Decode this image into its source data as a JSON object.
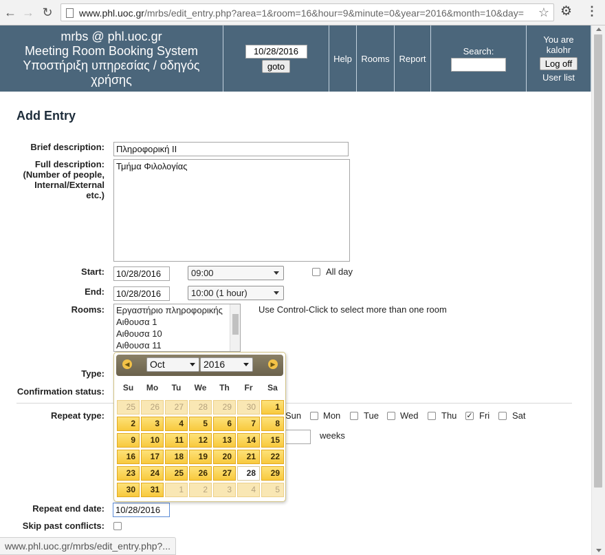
{
  "browser": {
    "back_icon": "back-arrow-icon",
    "forward_icon": "forward-arrow-icon",
    "reload_icon": "reload-icon",
    "url_host": "www.phl.uoc.gr",
    "url_path": "/mrbs/edit_entry.php?area=1&room=16&hour=9&minute=0&year=2016&month=10&day=",
    "status_url": "www.phl.uoc.gr/mrbs/edit_entry.php?..."
  },
  "banner": {
    "title_lines": [
      "mrbs @ phl.uoc.gr",
      "Meeting Room Booking System",
      "Υποστήριξη υπηρεσίας / οδηγός",
      "χρήσης"
    ],
    "goto_date": "10/28/2016",
    "goto_label": "goto",
    "help": "Help",
    "rooms": "Rooms",
    "report": "Report",
    "search_label": "Search:",
    "you_are": "You are",
    "user": "kalohr",
    "logoff": "Log off",
    "user_list": "User list",
    "bg_color": "#4b667b"
  },
  "form": {
    "heading": "Add Entry",
    "brief_label": "Brief description:",
    "brief_value": "Πληροφορική ΙΙ",
    "full_label_lines": [
      "Full description:",
      "(Number of people,",
      "Internal/External",
      "etc.)"
    ],
    "full_value": "Τμήμα Φιλολογίας",
    "start_label": "Start:",
    "start_date": "10/28/2016",
    "start_time": "09:00",
    "allday_label": "All day",
    "end_label": "End:",
    "end_date": "10/28/2016",
    "end_time": "10:00  (1 hour)",
    "rooms_label": "Rooms:",
    "rooms": [
      "Εργαστήριο πληροφορικής",
      "Αιθουσα 1",
      "Αιθουσα 10",
      "Αιθουσα 11"
    ],
    "rooms_hint": "Use Control-Click to select more than one room",
    "type_label": "Type:",
    "confirm_label": "Confirmation status:",
    "repeat_type_label": "Repeat type:",
    "weekdays": [
      {
        "label": "Sun",
        "checked": false
      },
      {
        "label": "Mon",
        "checked": false
      },
      {
        "label": "Tue",
        "checked": false
      },
      {
        "label": "Wed",
        "checked": false
      },
      {
        "label": "Thu",
        "checked": false
      },
      {
        "label": "Fri",
        "checked": true
      },
      {
        "label": "Sat",
        "checked": false
      }
    ],
    "weeks_label": "weeks",
    "repeat_end_label": "Repeat end date:",
    "repeat_end_value": "10/28/2016",
    "skip_label": "Skip past conflicts:"
  },
  "datepicker": {
    "month": "Oct",
    "year": "2016",
    "prev_icon": "prev-month-icon",
    "next_icon": "next-month-icon",
    "dow": [
      "Su",
      "Mo",
      "Tu",
      "We",
      "Th",
      "Fr",
      "Sa"
    ],
    "weeks": [
      [
        "25",
        "26",
        "27",
        "28",
        "29",
        "30",
        "1"
      ],
      [
        "2",
        "3",
        "4",
        "5",
        "6",
        "7",
        "8"
      ],
      [
        "9",
        "10",
        "11",
        "12",
        "13",
        "14",
        "15"
      ],
      [
        "16",
        "17",
        "18",
        "19",
        "20",
        "21",
        "22"
      ],
      [
        "23",
        "24",
        "25",
        "26",
        "27",
        "28",
        "29"
      ],
      [
        "30",
        "31",
        "1",
        "2",
        "3",
        "4",
        "5"
      ]
    ],
    "today": "28"
  }
}
